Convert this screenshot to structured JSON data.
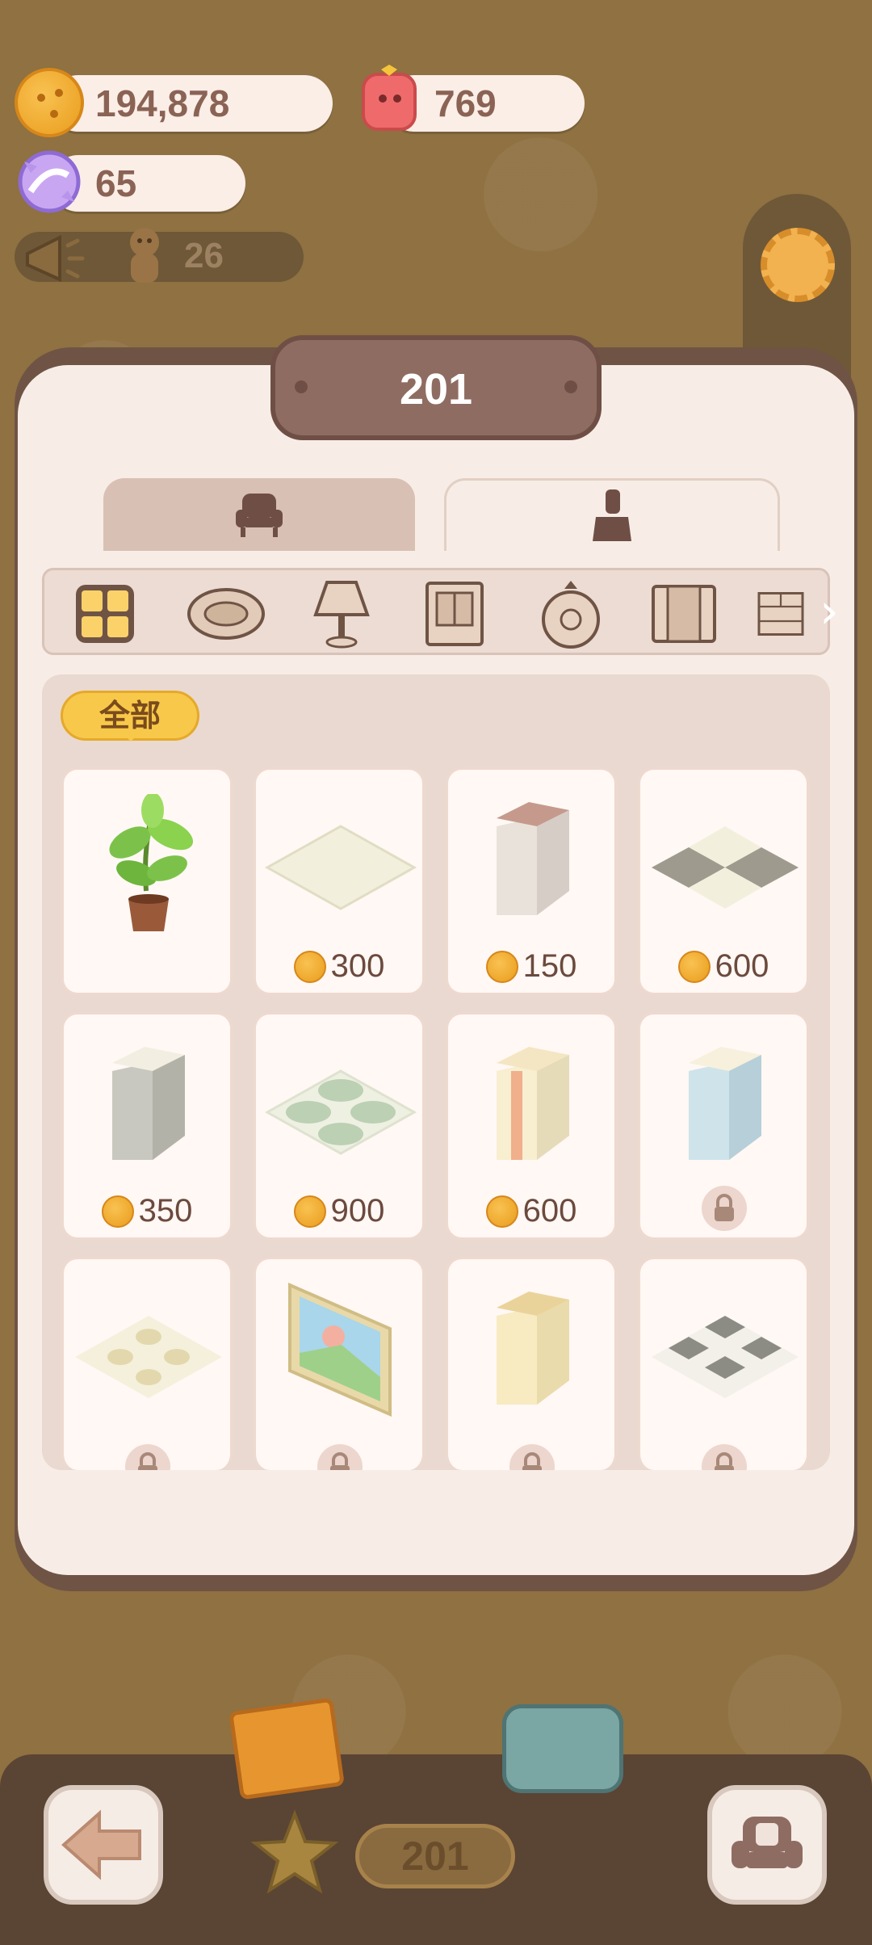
{
  "resources": {
    "cookies": "194,878",
    "gems": "769",
    "candy": "65",
    "ad_reward_count": "26"
  },
  "panel": {
    "title": "201",
    "tabs": [
      {
        "icon": "armchair-icon"
      },
      {
        "icon": "paint-brush-icon"
      }
    ],
    "categories": [
      "grid-icon",
      "rug-icon",
      "lamp-icon",
      "window-icon",
      "clock-icon",
      "wardrobe-icon",
      "wall-icon"
    ],
    "filter_label": "全部",
    "items": [
      {
        "name": "potted-plant",
        "price": "",
        "locked": false
      },
      {
        "name": "plain-floor",
        "price": "300",
        "locked": false
      },
      {
        "name": "wall-panel",
        "price": "150",
        "locked": false
      },
      {
        "name": "checker-floor",
        "price": "600",
        "locked": false
      },
      {
        "name": "gray-wall",
        "price": "350",
        "locked": false
      },
      {
        "name": "circle-floor",
        "price": "900",
        "locked": false
      },
      {
        "name": "striped-wall",
        "price": "600",
        "locked": false
      },
      {
        "name": "blue-wall",
        "price": "",
        "locked": true
      },
      {
        "name": "pattern-floor",
        "price": "",
        "locked": true
      },
      {
        "name": "painting-wall",
        "price": "",
        "locked": true
      },
      {
        "name": "cream-wall",
        "price": "",
        "locked": true
      },
      {
        "name": "tile-floor",
        "price": "",
        "locked": true
      }
    ]
  },
  "bottom_bar": {
    "room_number": "201"
  },
  "colors": {
    "background": "#8f7142",
    "panel": "#f7ede6",
    "accent": "#f8c84a"
  }
}
